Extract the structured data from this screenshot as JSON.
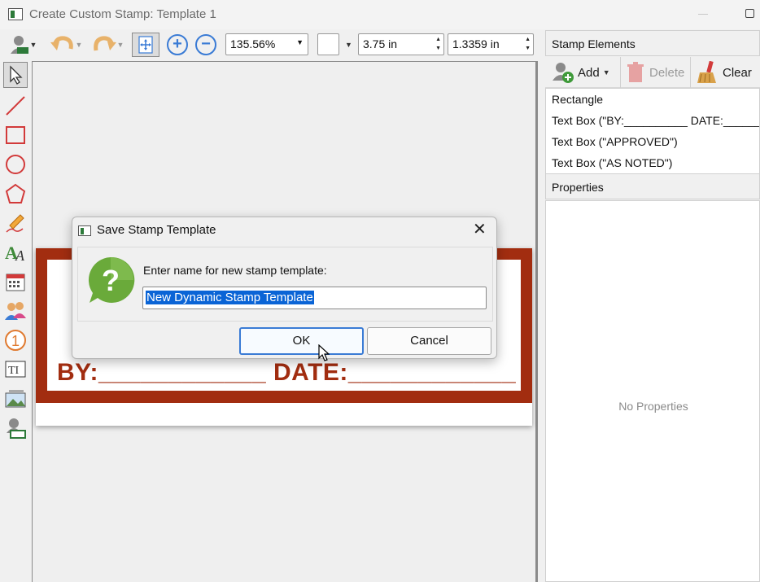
{
  "window": {
    "title": "Create Custom Stamp: Template 1"
  },
  "toolbar": {
    "zoom": "135.56%",
    "width": "3.75 in",
    "height": "1.3359 in",
    "icons": [
      "stamp-user-icon",
      "undo-icon",
      "redo-icon",
      "fit-page-icon",
      "zoom-in-icon",
      "zoom-out-icon",
      "color-swatch-icon"
    ]
  },
  "left_tools": [
    "select-arrow-icon",
    "line-icon",
    "rectangle-icon",
    "ellipse-icon",
    "polygon-icon",
    "pencil-icon",
    "text-style-icon",
    "calendar-icon",
    "users-icon",
    "number-icon",
    "text-box-icon",
    "image-icon",
    "stamp-icon"
  ],
  "stamp": {
    "byline": "BY:____________ DATE:____________"
  },
  "elements_panel": {
    "header": "Stamp Elements",
    "add_label": "Add",
    "delete_label": "Delete",
    "clear_label": "Clear",
    "items": [
      "Rectangle",
      "Text Box (\"BY:__________ DATE:________",
      "Text Box (\"APPROVED\")",
      "Text Box (\"AS NOTED\")"
    ]
  },
  "properties_panel": {
    "header": "Properties",
    "empty_text": "No Properties"
  },
  "dialog": {
    "title": "Save Stamp Template",
    "prompt": "Enter name for new stamp template:",
    "input_value": "New Dynamic Stamp Template",
    "ok_label": "OK",
    "cancel_label": "Cancel"
  },
  "colors": {
    "stamp_red": "#a22d10",
    "accent_blue": "#3a7bd5",
    "selection_blue": "#0a64d6",
    "question_green": "#6aaa3a"
  }
}
